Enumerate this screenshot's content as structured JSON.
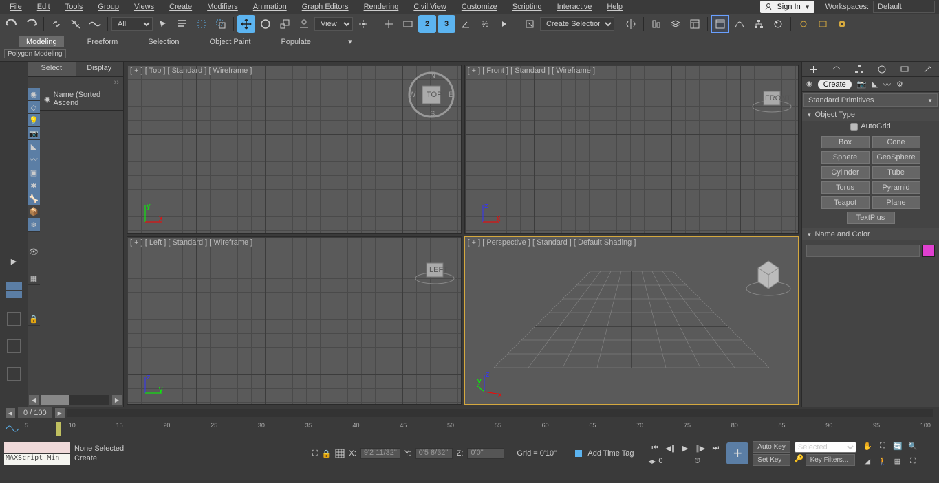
{
  "menus": [
    "File",
    "Edit",
    "Tools",
    "Group",
    "Views",
    "Create",
    "Modifiers",
    "Animation",
    "Graph Editors",
    "Rendering",
    "Civil View",
    "Customize",
    "Scripting",
    "Interactive",
    "Help"
  ],
  "signin_label": "Sign In",
  "workspace_label": "Workspaces:",
  "workspace_value": "Default",
  "toolbar": {
    "filter_all": "All",
    "view_label": "View",
    "named_selection": "Create Selection Se"
  },
  "ribbon_tabs": [
    "Modeling",
    "Freeform",
    "Selection",
    "Object Paint",
    "Populate"
  ],
  "ribbon_active": 0,
  "ribbon_sub": "Polygon Modeling",
  "scene": {
    "tabs": [
      "Select",
      "Display"
    ],
    "active": 0,
    "header": "Name (Sorted Ascend"
  },
  "viewports": [
    {
      "label": "[ + ] [ Top ] [ Standard ] [ Wireframe ]",
      "active": false,
      "persp": false
    },
    {
      "label": "[ + ] [ Front ] [ Standard ] [ Wireframe ]",
      "active": false,
      "persp": false
    },
    {
      "label": "[ + ] [ Left ] [ Standard ] [ Wireframe ]",
      "active": false,
      "persp": false
    },
    {
      "label": "[ + ] [ Perspective ] [ Standard ] [ Default Shading ]",
      "active": true,
      "persp": true
    }
  ],
  "command_panel": {
    "create_pill": "Create",
    "category": "Standard Primitives",
    "rollout1": "Object Type",
    "autogrid": "AutoGrid",
    "buttons": [
      "Box",
      "Cone",
      "Sphere",
      "GeoSphere",
      "Cylinder",
      "Tube",
      "Torus",
      "Pyramid",
      "Teapot",
      "Plane",
      "TextPlus"
    ],
    "rollout2": "Name and Color"
  },
  "timeline": {
    "frame": "0 / 100",
    "ticks": [
      "5",
      "10",
      "15",
      "20",
      "25",
      "30",
      "35",
      "40",
      "45",
      "50",
      "55",
      "60",
      "65",
      "70",
      "75",
      "80",
      "85",
      "90",
      "95",
      "100"
    ]
  },
  "status": {
    "maxscript": "MAXScript Min",
    "selection": "None Selected",
    "prompt": "Create",
    "x_label": "X:",
    "x": "9'2 11/32\"",
    "y_label": "Y:",
    "y": "0'5 8/32\"",
    "z_label": "Z:",
    "z": "0'0\"",
    "grid": "Grid = 0'10\"",
    "time_tag": "Add Time Tag",
    "frame_field": "0",
    "auto_key": "Auto Key",
    "set_key": "Set Key",
    "selected": "Selected",
    "key_filters": "Key Filters..."
  }
}
